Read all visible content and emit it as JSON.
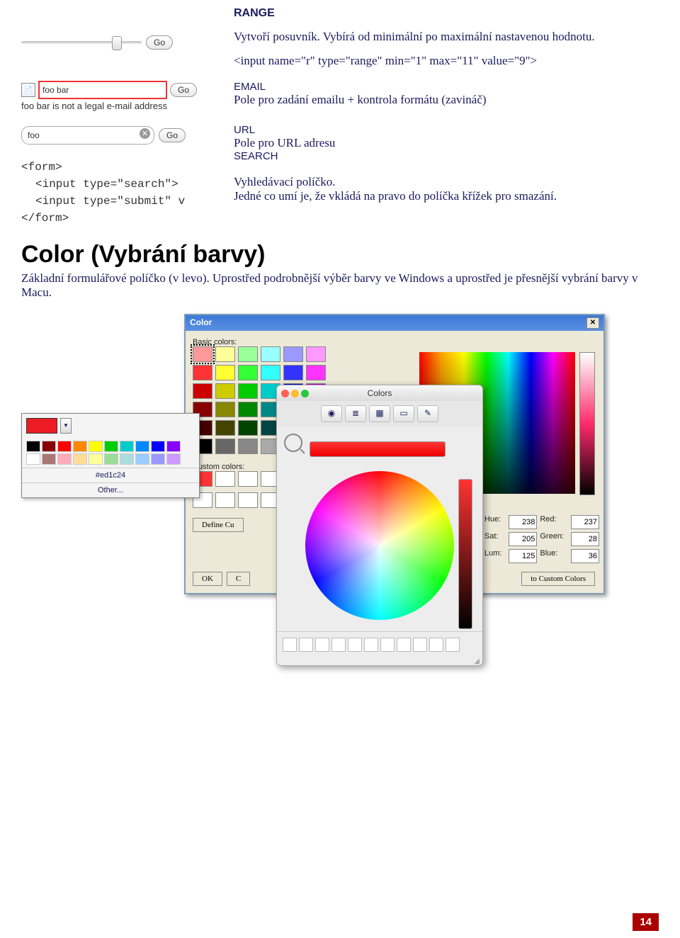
{
  "range": {
    "heading": "RANGE",
    "desc": "Vytvoří posuvník. Vybírá od minimální po maximální nastavenou hodnotu.",
    "code": "<input name=\"r\" type=\"range\" min=\"1\" max=\"11\" value=\"9\">",
    "go": "Go"
  },
  "email": {
    "heading": "EMAIL",
    "desc": "Pole pro zadání emailu + kontrola formátu (zavináč)",
    "input_value": "foo bar",
    "go": "Go",
    "error": "foo bar is not a legal e-mail address"
  },
  "url": {
    "heading": "URL",
    "desc": "Pole pro URL adresu"
  },
  "search": {
    "heading": "SEARCH",
    "desc": "Vyhledávací políčko.",
    "desc2": "Jedné co umí je, že vkládá na pravo do políčka křížek pro smazání.",
    "input_value": "foo",
    "go": "Go"
  },
  "code": {
    "l1": "<form>",
    "l2": "<input type=\"search\">",
    "l3": "<input type=\"submit\" v",
    "l4": "</form>"
  },
  "color": {
    "heading": "Color (Vybrání barvy)",
    "sub": "Základní formulářové políčko (v levo). Uprostřed podrobnější výběr barvy ve Windows a uprostřed je přesnější vybrání barvy v Macu."
  },
  "simple": {
    "hex": "#ed1c24",
    "other": "Other...",
    "palette_row1": [
      "#000",
      "#800",
      "#f00",
      "#f80",
      "#ff0",
      "#0c0",
      "#0cc",
      "#08f",
      "#00f",
      "#80f"
    ],
    "palette_row2": [
      "#fff",
      "#a77",
      "#fab",
      "#fd9",
      "#ff9",
      "#9d9",
      "#add",
      "#9cf",
      "#99f",
      "#c9f"
    ]
  },
  "win": {
    "title": "Color",
    "basic": "Basic colors:",
    "custom": "Custom colors:",
    "define": "Define Cu",
    "ok": "OK",
    "cancel": "C",
    "add": "to Custom Colors",
    "fields": {
      "hue_l": "Hue:",
      "hue_v": "238",
      "sat_l": "Sat:",
      "sat_v": "205",
      "lum_l": "Lum:",
      "lum_v": "125",
      "red_l": "Red:",
      "red_v": "237",
      "green_l": "Green:",
      "green_v": "28",
      "blue_l": "Blue:",
      "blue_v": "36"
    },
    "basic_colors": [
      "#f99",
      "#ff9",
      "#9f9",
      "#9ff",
      "#99f",
      "#f9f",
      "#f33",
      "#ff3",
      "#3f3",
      "#3ff",
      "#33f",
      "#f3f",
      "#c00",
      "#cc0",
      "#0c0",
      "#0cc",
      "#00c",
      "#c0c",
      "#800",
      "#880",
      "#080",
      "#088",
      "#008",
      "#808",
      "#400",
      "#440",
      "#040",
      "#044",
      "#004",
      "#404",
      "#000",
      "#666",
      "#888",
      "#aaa",
      "#ccc",
      "#fff"
    ]
  },
  "mac": {
    "title": "Colors"
  },
  "page": "14"
}
